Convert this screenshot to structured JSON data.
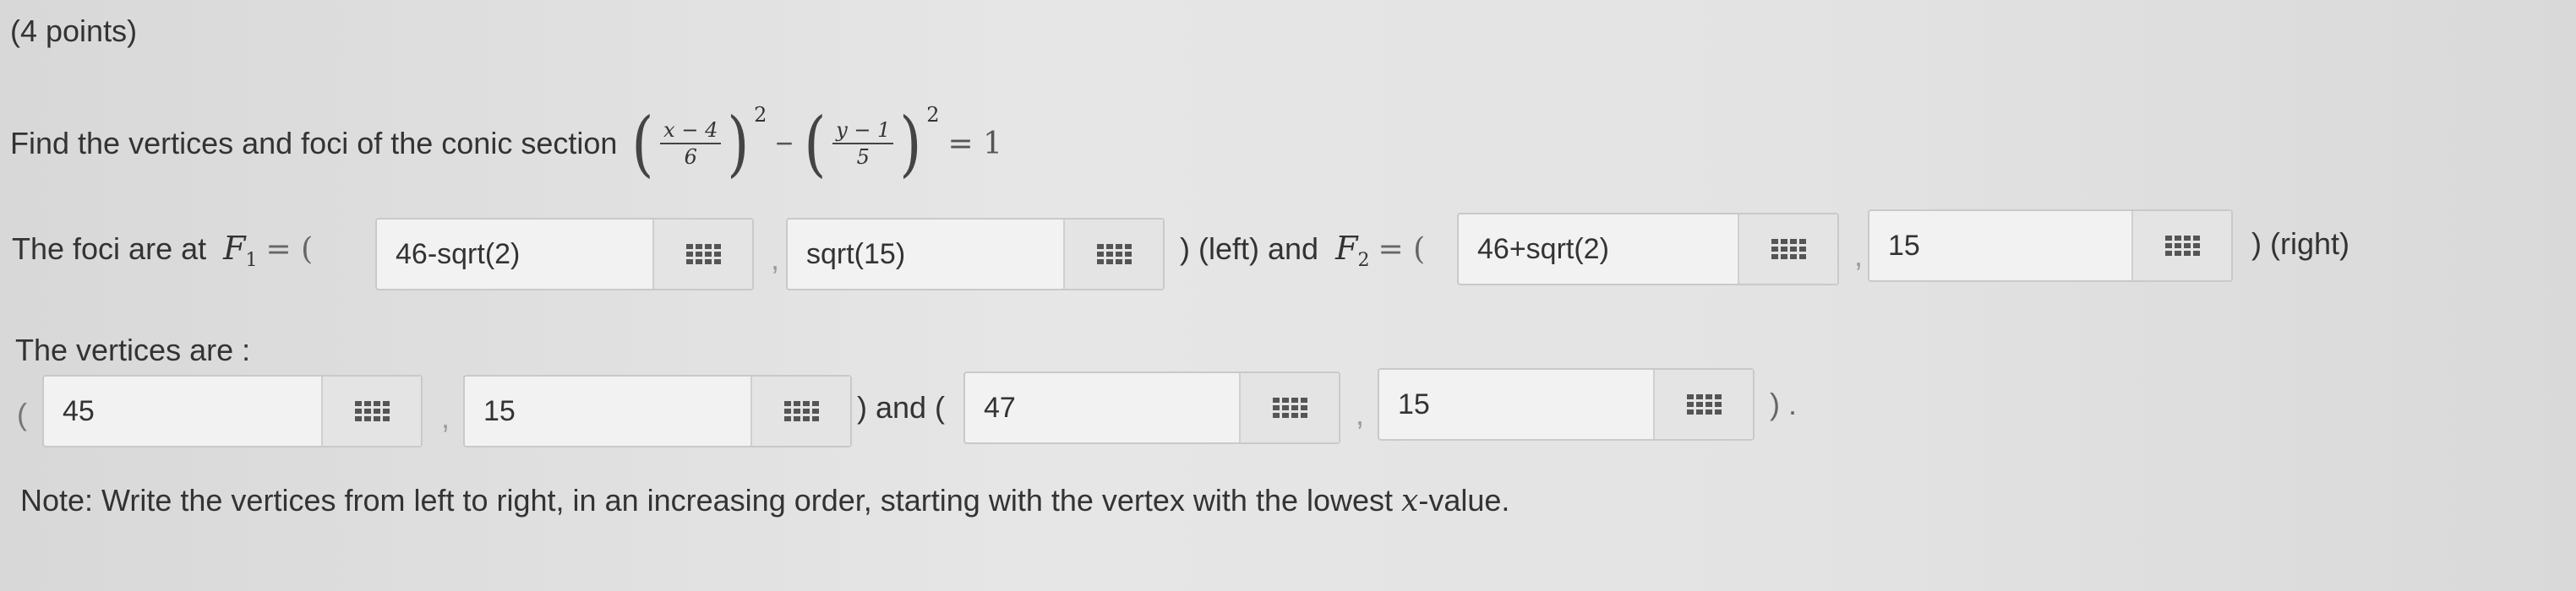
{
  "header": {
    "points": "(4 points)"
  },
  "problem": {
    "prompt": "Find the vertices and foci of the conic section",
    "equation": {
      "term1_num": "x − 4",
      "term1_den": "6",
      "term2_num": "y − 1",
      "term2_den": "5",
      "exponent": "2",
      "minus": "−",
      "equals": "= 1"
    }
  },
  "foci": {
    "prefix": "The foci are at",
    "f1_symbol": "F",
    "f1_sub": "1",
    "eq_open": "= (",
    "f1_x": "46-sqrt(2)",
    "f1_y": "sqrt(15)",
    "left_label": ") (left) and",
    "f2_symbol": "F",
    "f2_sub": "2",
    "f2_x": "46+sqrt(2)",
    "f2_y": "15",
    "right_label": ") (right)",
    "comma": ","
  },
  "vertices": {
    "label": "The vertices are :",
    "open_paren": "(",
    "v1_x": "45",
    "v1_y": "15",
    "and_label": ") and (",
    "v2_x": "47",
    "v2_y": "15",
    "close": ") .",
    "comma": ","
  },
  "note": {
    "text_before": "Note: Write the vertices from left to right, in an increasing order, starting with the vertex with the lowest ",
    "var": "x",
    "text_after": "-value."
  },
  "icons": {
    "keypad": "keypad-grid-icon"
  }
}
